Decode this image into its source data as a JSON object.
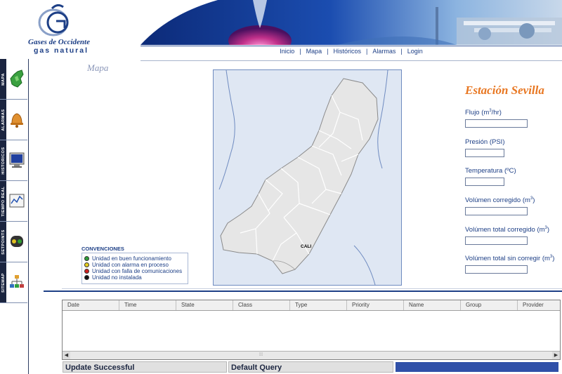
{
  "brand": {
    "line1": "Gases de Occidente",
    "line2": "gas natural"
  },
  "nav": {
    "items": [
      "Inicio",
      "Mapa",
      "Históricos",
      "Alarmas",
      "Login"
    ],
    "separator": "|"
  },
  "section_title": "Mapa",
  "sidebar": {
    "items": [
      {
        "label": "MAPA",
        "icon": "map-icon"
      },
      {
        "label": "ALARMAS",
        "icon": "bell-icon"
      },
      {
        "label": "HISTORICOS",
        "icon": "monitor-icon"
      },
      {
        "label": "TIEMPO REAL",
        "icon": "chart-icon"
      },
      {
        "label": "SETPOINTS",
        "icon": "traffic-light-icon"
      },
      {
        "label": "SITEMAP",
        "icon": "sitemap-icon"
      }
    ]
  },
  "map": {
    "city_label": "CALI"
  },
  "legend": {
    "title": "CONVENCIONES",
    "items": [
      {
        "label": "Unidad en buen funcionamiento",
        "color": "#2e9e3a"
      },
      {
        "label": "Unidad con alarma en proceso",
        "color": "#e8d020"
      },
      {
        "label": "Unidad con falla de comunicaciones",
        "color": "#d02020"
      },
      {
        "label": "Unidad no instalada",
        "color": "#111111"
      }
    ]
  },
  "station": {
    "title": "Estación Sevilla",
    "fields": [
      {
        "label_pre": "Flujo (m",
        "sup": "3",
        "label_post": "/hr)",
        "value": ""
      },
      {
        "label_pre": "Presión (PSI)",
        "sup": "",
        "label_post": "",
        "value": ""
      },
      {
        "label_pre": "Temperatura (ºC)",
        "sup": "",
        "label_post": "",
        "value": ""
      },
      {
        "label_pre": "Volúmen corregido (m",
        "sup": "3",
        "label_post": ")",
        "value": ""
      },
      {
        "label_pre": "Volúmen total corregido (m",
        "sup": "3",
        "label_post": ")",
        "value": ""
      },
      {
        "label_pre": "Volúmen total sin corregir (m",
        "sup": "3",
        "label_post": ")",
        "value": ""
      }
    ]
  },
  "alarm_table": {
    "columns": [
      "Date",
      "Time",
      "State",
      "Class",
      "Type",
      "Priority",
      "Name",
      "Group",
      "Provider"
    ],
    "rows": [],
    "scroll_grip": "⁞⁞⁞"
  },
  "status_bar": {
    "message": "Update Successful",
    "query": "Default Query"
  },
  "colors": {
    "accent": "#e87722",
    "navy": "#1d3f86",
    "progress": "#3050a8"
  }
}
